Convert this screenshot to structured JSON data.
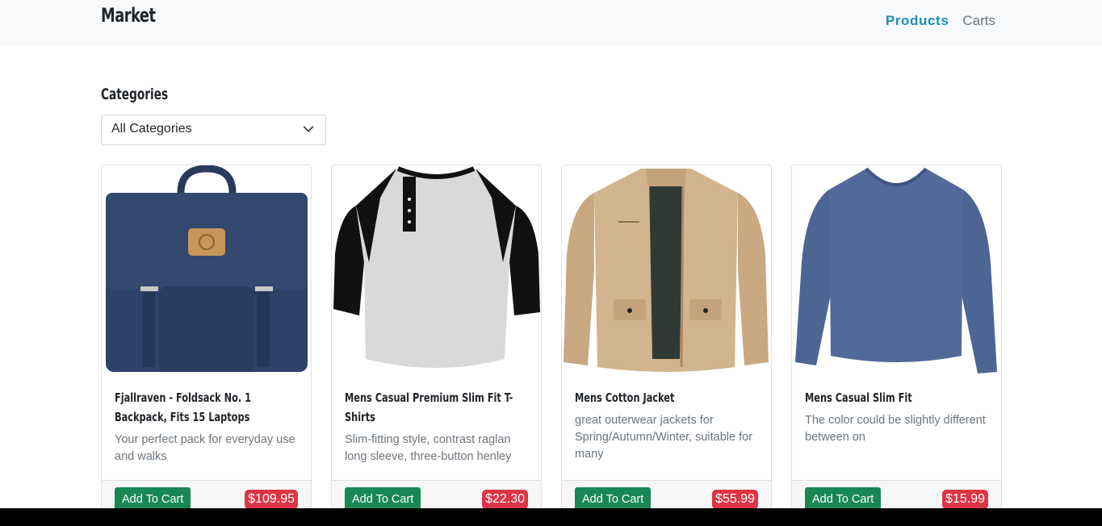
{
  "navbar": {
    "brand": "Market",
    "links": [
      {
        "label": "Products",
        "active": true
      },
      {
        "label": "Carts",
        "active": false
      }
    ]
  },
  "filters": {
    "label": "Categories",
    "selected": "All Categories"
  },
  "products": [
    {
      "title": "Fjallraven - Foldsack No. 1 Backpack, Fits 15 Laptops",
      "description": "Your perfect pack for everyday use and walks",
      "button": "Add To Cart",
      "price": "$109.95",
      "image": "backpack-image"
    },
    {
      "title": "Mens Casual Premium Slim Fit T-Shirts",
      "description": "Slim-fitting style, contrast raglan long sleeve, three-button henley",
      "button": "Add To Cart",
      "price": "$22.30",
      "image": "tshirt-image"
    },
    {
      "title": "Mens Cotton Jacket",
      "description": "great outerwear jackets for Spring/Autumn/Winter, suitable for many",
      "button": "Add To Cart",
      "price": "$55.99",
      "image": "jacket-image"
    },
    {
      "title": "Mens Casual Slim Fit",
      "description": "The color could be slightly different between on",
      "button": "Add To Cart",
      "price": "$15.99",
      "image": "longsleeve-image"
    }
  ],
  "colors": {
    "accent": "#1a8fb8",
    "button": "#198754",
    "price_badge": "#dc3545"
  }
}
